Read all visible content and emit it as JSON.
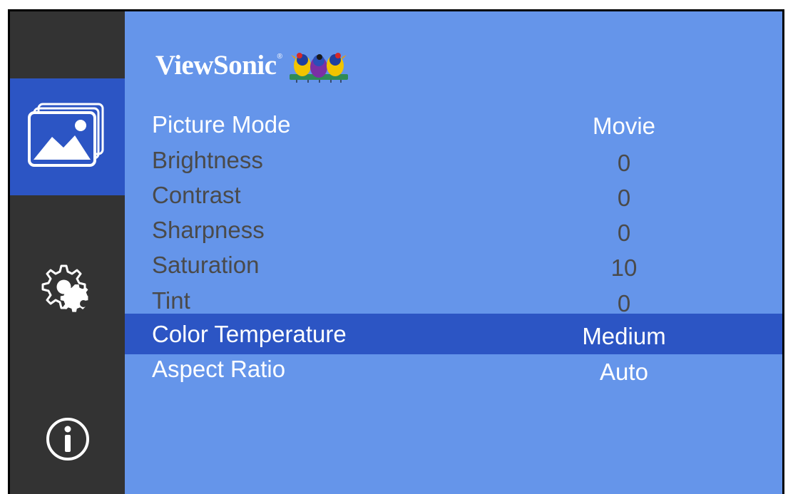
{
  "brand": {
    "name": "ViewSonic",
    "registered_mark": "®",
    "logo_icon": "viewsonic-birds-logo"
  },
  "sidebar": {
    "items": [
      {
        "icon": "picture-icon",
        "active": true
      },
      {
        "icon": "settings-gears-icon",
        "active": false
      },
      {
        "icon": "info-icon",
        "active": false
      }
    ]
  },
  "menu": {
    "items": [
      {
        "label": "Picture Mode",
        "value": "Movie",
        "enabled": true,
        "selected": false
      },
      {
        "label": "Brightness",
        "value": "0",
        "enabled": false,
        "selected": false
      },
      {
        "label": "Contrast",
        "value": "0",
        "enabled": false,
        "selected": false
      },
      {
        "label": "Sharpness",
        "value": "0",
        "enabled": false,
        "selected": false
      },
      {
        "label": "Saturation",
        "value": "10",
        "enabled": false,
        "selected": false
      },
      {
        "label": "Tint",
        "value": "0",
        "enabled": false,
        "selected": false
      },
      {
        "label": "Color Temperature",
        "value": "Medium",
        "enabled": true,
        "selected": true
      },
      {
        "label": "Aspect Ratio",
        "value": "Auto",
        "enabled": true,
        "selected": false
      }
    ]
  },
  "colors": {
    "background": "#6595ea",
    "sidebar": "#333333",
    "highlight": "#2c55c4",
    "enabled_text": "#ffffff",
    "disabled_text": "#4a4a4a"
  }
}
